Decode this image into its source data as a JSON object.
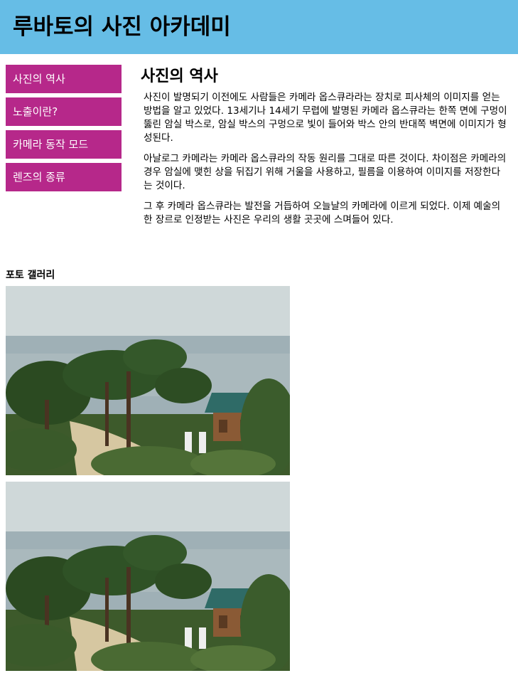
{
  "header": {
    "title": "루바토의 사진 아카데미"
  },
  "nav": {
    "items": [
      {
        "label": "사진의 역사"
      },
      {
        "label": "노출이란?"
      },
      {
        "label": "카메라 동작 모드"
      },
      {
        "label": "렌즈의 종류"
      }
    ]
  },
  "main": {
    "title": "사진의 역사",
    "paragraphs": [
      "사진이 발명되기 이전에도 사람들은 카메라 옵스큐라라는 장치로 피사체의 이미지를 얻는 방법을 알고 있었다. 13세기나 14세기 무렵에 발명된 카메라 옵스큐라는 한쪽 면에 구멍이 뚫린 암실 박스로, 암실 박스의 구멍으로 빛이 들어와 박스 안의 반대쪽 벽면에 이미지가 형성된다.",
      "아날로그 카메라는 카메라 옵스큐라의 작동 원리를 그대로 따른 것이다. 차이점은 카메라의 경우 암실에 맺힌 상을 뒤집기 위해 거울을 사용하고, 필름을 이용하여 이미지를 저장한다는 것이다.",
      "그 후 카메라 옵스큐라는 발전을 거듭하여 오늘날의 카메라에 이르게 되었다. 이제 예술의 한 장르로 인정받는 사진은 우리의 생활 곳곳에 스며들어 있다."
    ]
  },
  "gallery": {
    "title": "포토 갤러리"
  },
  "colors": {
    "header_bg": "#66bde6",
    "nav_bg": "#b6288a",
    "nav_text": "#ffffff"
  }
}
